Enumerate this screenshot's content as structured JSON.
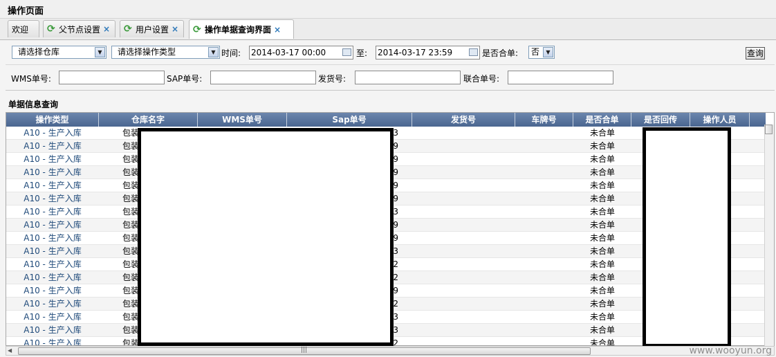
{
  "header": {
    "title": "操作页面"
  },
  "tabs": [
    {
      "label": "欢迎",
      "icon": "",
      "closable": false,
      "active": false
    },
    {
      "label": "父节点设置",
      "icon": "refresh-icon",
      "closable": true,
      "active": false
    },
    {
      "label": "用户设置",
      "icon": "refresh-icon",
      "closable": true,
      "active": false
    },
    {
      "label": "操作单据查询界面",
      "icon": "refresh-icon",
      "closable": true,
      "active": true
    }
  ],
  "filters": {
    "warehouse_select": "请选择仓库",
    "optype_select": "请选择操作类型",
    "time_label": "时间:",
    "time_from": "2014-03-17 00:00",
    "to_label": "至:",
    "time_to": "2014-03-17 23:59",
    "merged_label": "是否合单:",
    "merged_value": "否",
    "query_button": "查询",
    "wms_label": "WMS单号:",
    "wms_value": "",
    "sap_label": "SAP单号:",
    "sap_value": "",
    "ship_label": "发货号:",
    "ship_value": "",
    "joint_label": "联合单号:",
    "joint_value": ""
  },
  "section_title": "单据信息查询",
  "grid": {
    "columns": [
      "操作类型",
      "仓库名字",
      "WMS单号",
      "Sap单号",
      "发货号",
      "车牌号",
      "是否合单",
      "是否回传",
      "操作人员"
    ],
    "rows": [
      {
        "type": "A10 - 生产入库",
        "warehouse": "包装",
        "sap_tail": "3",
        "merged": "未合单"
      },
      {
        "type": "A10 - 生产入库",
        "warehouse": "包装",
        "sap_tail": "9",
        "merged": "未合单"
      },
      {
        "type": "A10 - 生产入库",
        "warehouse": "包装",
        "sap_tail": "9",
        "merged": "未合单"
      },
      {
        "type": "A10 - 生产入库",
        "warehouse": "包装",
        "sap_tail": "9",
        "merged": "未合单"
      },
      {
        "type": "A10 - 生产入库",
        "warehouse": "包装",
        "sap_tail": "9",
        "merged": "未合单"
      },
      {
        "type": "A10 - 生产入库",
        "warehouse": "包装",
        "sap_tail": "9",
        "merged": "未合单"
      },
      {
        "type": "A10 - 生产入库",
        "warehouse": "包装",
        "sap_tail": "3",
        "merged": "未合单"
      },
      {
        "type": "A10 - 生产入库",
        "warehouse": "包装",
        "sap_tail": "9",
        "merged": "未合单"
      },
      {
        "type": "A10 - 生产入库",
        "warehouse": "包装",
        "sap_tail": "9",
        "merged": "未合单"
      },
      {
        "type": "A10 - 生产入库",
        "warehouse": "包装",
        "sap_tail": "3",
        "merged": "未合单"
      },
      {
        "type": "A10 - 生产入库",
        "warehouse": "包装",
        "sap_tail": "2",
        "merged": "未合单"
      },
      {
        "type": "A10 - 生产入库",
        "warehouse": "包装",
        "sap_tail": "2",
        "merged": "未合单"
      },
      {
        "type": "A10 - 生产入库",
        "warehouse": "包装",
        "sap_tail": "9",
        "merged": "未合单"
      },
      {
        "type": "A10 - 生产入库",
        "warehouse": "包装",
        "sap_tail": "2",
        "merged": "未合单"
      },
      {
        "type": "A10 - 生产入库",
        "warehouse": "包装",
        "sap_tail": "3",
        "merged": "未合单"
      },
      {
        "type": "A10 - 生产入库",
        "warehouse": "包装",
        "sap_tail": "3",
        "merged": "未合单"
      },
      {
        "type": "A10 - 生产入库",
        "warehouse": "包装",
        "sap_tail": "2",
        "merged": "未合单"
      }
    ]
  },
  "watermark": "www.wooyun.org"
}
